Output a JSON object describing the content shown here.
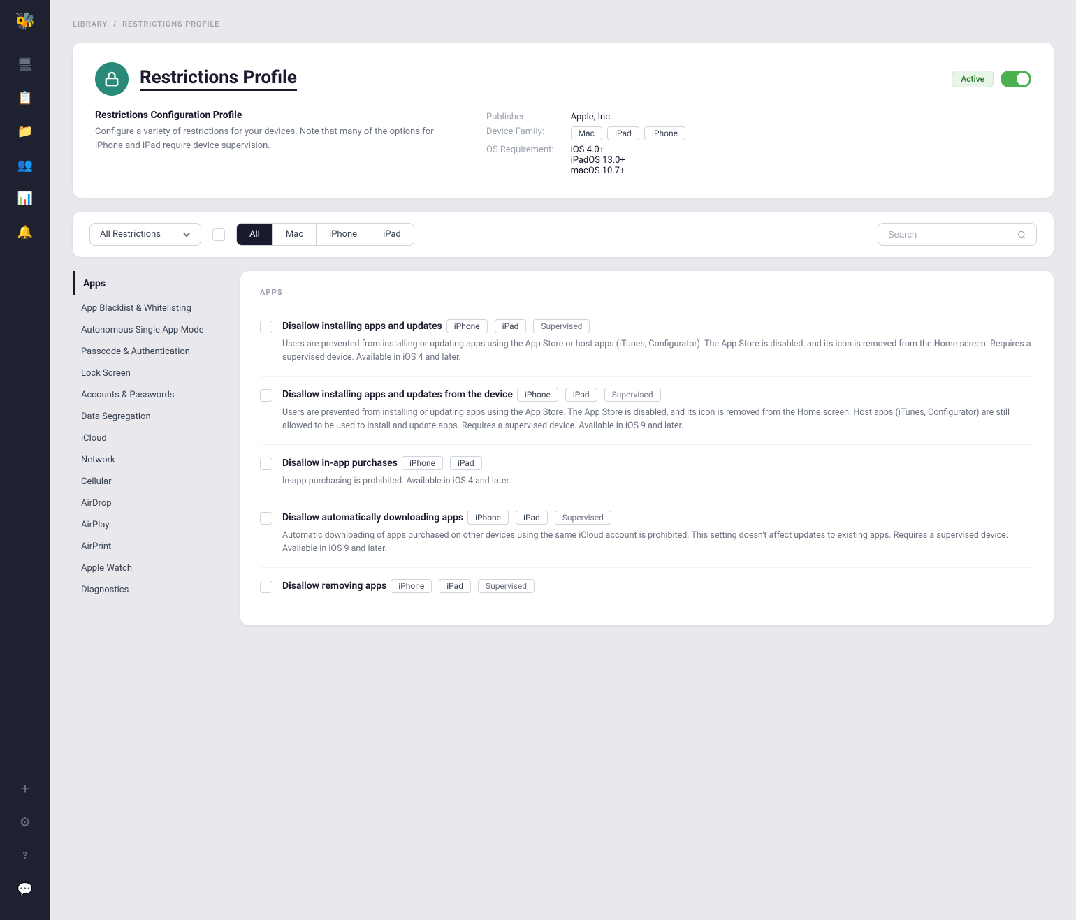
{
  "sidebar": {
    "logo": "🐝",
    "nav_items": [
      {
        "name": "monitor-icon",
        "icon": "🖥",
        "active": false
      },
      {
        "name": "reports-icon",
        "icon": "📋",
        "active": false
      },
      {
        "name": "folder-icon",
        "icon": "📁",
        "active": false
      },
      {
        "name": "users-icon",
        "icon": "👥",
        "active": false
      },
      {
        "name": "analytics-icon",
        "icon": "📊",
        "active": false
      },
      {
        "name": "bell-icon",
        "icon": "🔔",
        "active": false
      }
    ],
    "bottom_items": [
      {
        "name": "add-icon",
        "icon": "+"
      },
      {
        "name": "settings-icon",
        "icon": "⚙"
      },
      {
        "name": "help-icon",
        "icon": "?"
      },
      {
        "name": "chat-icon",
        "icon": "💬"
      }
    ]
  },
  "breadcrumb": {
    "library": "LIBRARY",
    "separator": "/",
    "current": "RESTRICTIONS PROFILE"
  },
  "profile": {
    "icon": "🔒",
    "title": "Restrictions Profile",
    "status_badge": "Active",
    "description_title": "Restrictions Configuration Profile",
    "description": "Configure a variety of restrictions for your devices. Note that many of the options for iPhone and iPad require device supervision.",
    "publisher_label": "Publisher:",
    "publisher_value": "Apple, Inc.",
    "device_family_label": "Device Family:",
    "device_family_tags": [
      "Mac",
      "iPad",
      "iPhone"
    ],
    "os_req_label": "OS Requirement:",
    "os_reqs": [
      "iOS 4.0+",
      "iPadOS 13.0+",
      "macOS 10.7+"
    ]
  },
  "filter_bar": {
    "dropdown_label": "All Restrictions",
    "tabs": [
      {
        "label": "All",
        "active": true
      },
      {
        "label": "Mac",
        "active": false
      },
      {
        "label": "iPhone",
        "active": false
      },
      {
        "label": "iPad",
        "active": false
      }
    ],
    "search_placeholder": "Search"
  },
  "left_nav": {
    "section": "Apps",
    "items": [
      "App Blacklist & Whitelisting",
      "Autonomous Single App Mode",
      "Passcode & Authentication",
      "Lock Screen",
      "Accounts & Passwords",
      "Data Segregation",
      "iCloud",
      "Network",
      "Cellular",
      "AirDrop",
      "AirPlay",
      "AirPrint",
      "Apple Watch",
      "Diagnostics"
    ]
  },
  "restrictions": {
    "section_title": "APPS",
    "items": [
      {
        "name": "Disallow installing apps and updates",
        "tags": [
          "iPhone",
          "iPad",
          "Supervised"
        ],
        "description": "Users are prevented from installing or updating apps using the App Store or host apps (iTunes, Configurator). The App Store is disabled, and its icon is removed from the Home screen. Requires a supervised device. Available in iOS 4 and later."
      },
      {
        "name": "Disallow installing apps and updates from the device",
        "tags": [
          "iPhone",
          "iPad",
          "Supervised"
        ],
        "description": "Users are prevented from installing or updating apps using the App Store. The App Store is disabled, and its icon is removed from the Home screen. Host apps (iTunes, Configurator) are still allowed to be used to install and update apps. Requires a supervised device. Available in iOS 9 and later."
      },
      {
        "name": "Disallow in-app purchases",
        "tags": [
          "iPhone",
          "iPad"
        ],
        "description": "In-app purchasing is prohibited. Available in iOS 4 and later."
      },
      {
        "name": "Disallow automatically downloading apps",
        "tags": [
          "iPhone",
          "iPad",
          "Supervised"
        ],
        "description": "Automatic downloading of apps purchased on other devices using the same iCloud account is prohibited. This setting doesn't affect updates to existing apps. Requires a supervised device. Available in iOS 9 and later."
      },
      {
        "name": "Disallow removing apps",
        "tags": [
          "iPhone",
          "iPad",
          "Supervised"
        ],
        "description": ""
      }
    ]
  }
}
